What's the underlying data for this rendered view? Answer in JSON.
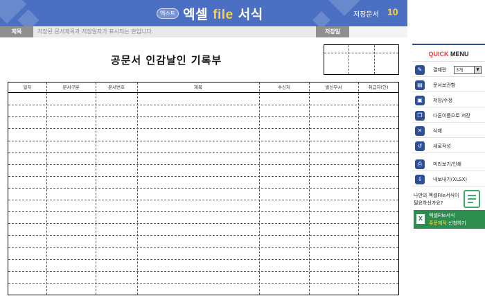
{
  "header": {
    "logo_badge": "엑스트",
    "logo_prefix": "엑셀",
    "logo_file": "file",
    "logo_suffix": "서식",
    "saved_label": "저장문서",
    "saved_count": "10"
  },
  "titlebar": {
    "title_label": "제목",
    "title_placeholder": "저장된 문서제목과 저장일자가 표시되는 란입니다.",
    "date_label": "저장일"
  },
  "document": {
    "title": "공문서 인감날인 기록부",
    "columns": [
      "일자",
      "문서구분",
      "문서번호",
      "제목",
      "수신처",
      "발신부서",
      "취급자(인)"
    ],
    "row_count": 17
  },
  "quick_menu": {
    "title_q": "QUICK",
    "title_rest": "MENU",
    "approval_label": "결재란",
    "approval_value": "3개",
    "items": [
      {
        "label": "문서보관함",
        "icon": "archive-icon"
      },
      {
        "label": "저장/수정",
        "icon": "save-icon"
      },
      {
        "label": "다른이름으로 저장",
        "icon": "save-as-icon"
      },
      {
        "label": "삭제",
        "icon": "delete-icon"
      },
      {
        "label": "새로작성",
        "icon": "new-document-icon"
      },
      {
        "label": "미리보기/인쇄",
        "icon": "print-icon"
      },
      {
        "label": "내보내기(XLSX)",
        "icon": "export-icon"
      }
    ]
  },
  "promo": {
    "line1": "나만의 엑셀File서식이",
    "line2": "필요하신가요?",
    "button_line1": "엑셀File서식",
    "button_line2_highlight": "주문제작",
    "button_line2_rest": " 신청하기",
    "icon_letter": "X"
  },
  "colors": {
    "banner": "#4a6fc3",
    "accent_yellow": "#ffd23a",
    "menu_icon": "#2f4f95",
    "promo_green": "#2d8d4e"
  }
}
